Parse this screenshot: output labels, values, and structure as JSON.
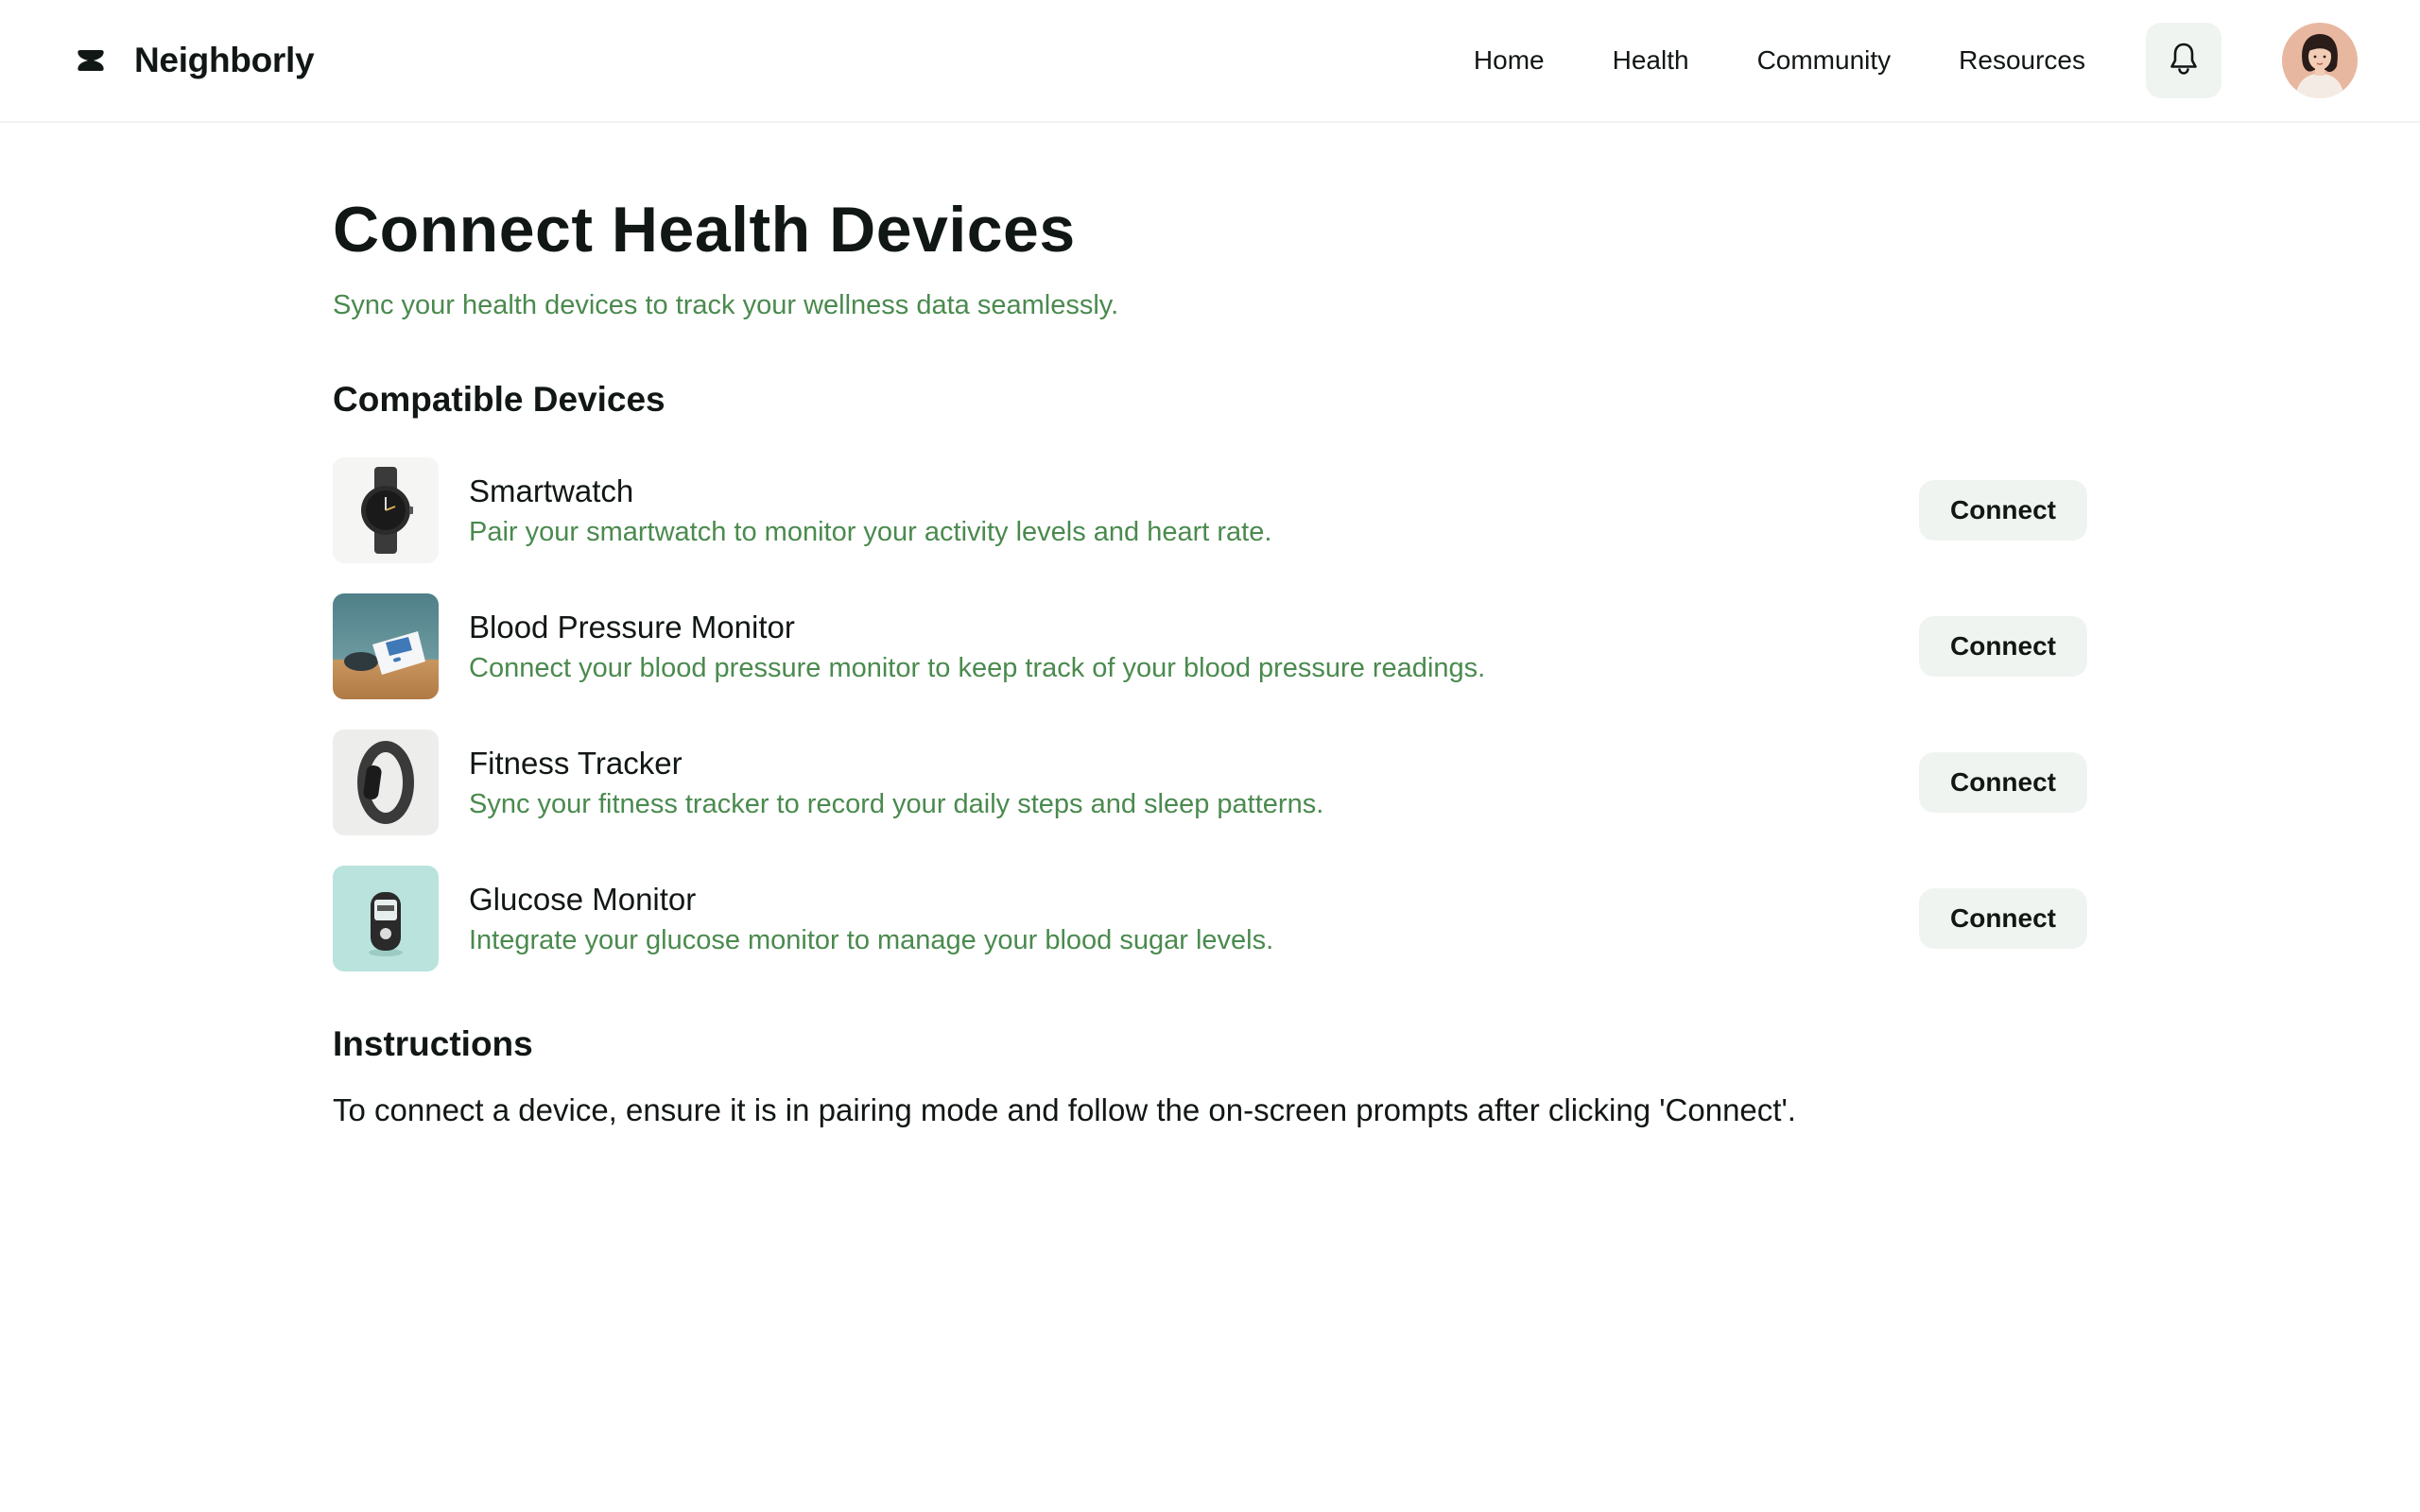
{
  "header": {
    "brand_name": "Neighborly",
    "nav": [
      {
        "label": "Home"
      },
      {
        "label": "Health"
      },
      {
        "label": "Community"
      },
      {
        "label": "Resources"
      }
    ]
  },
  "main": {
    "title": "Connect Health Devices",
    "subtitle": "Sync your health devices to track your wellness data seamlessly.",
    "compatible_title": "Compatible Devices",
    "devices": [
      {
        "name": "Smartwatch",
        "description": "Pair your smartwatch to monitor your activity levels and heart rate.",
        "button": "Connect",
        "icon": "smartwatch-image"
      },
      {
        "name": "Blood Pressure Monitor",
        "description": "Connect your blood pressure monitor to keep track of your blood pressure readings.",
        "button": "Connect",
        "icon": "blood-pressure-monitor-image"
      },
      {
        "name": "Fitness Tracker",
        "description": "Sync your fitness tracker to record your daily steps and sleep patterns.",
        "button": "Connect",
        "icon": "fitness-tracker-image"
      },
      {
        "name": "Glucose Monitor",
        "description": "Integrate your glucose monitor to manage your blood sugar levels.",
        "button": "Connect",
        "icon": "glucose-monitor-image"
      }
    ],
    "instructions_title": "Instructions",
    "instructions_text": "To connect a device, ensure it is in pairing mode and follow the on-screen prompts after clicking 'Connect'."
  },
  "colors": {
    "accent_text": "#4a8a4e",
    "button_bg": "#f0f4f1",
    "text": "#111714"
  }
}
